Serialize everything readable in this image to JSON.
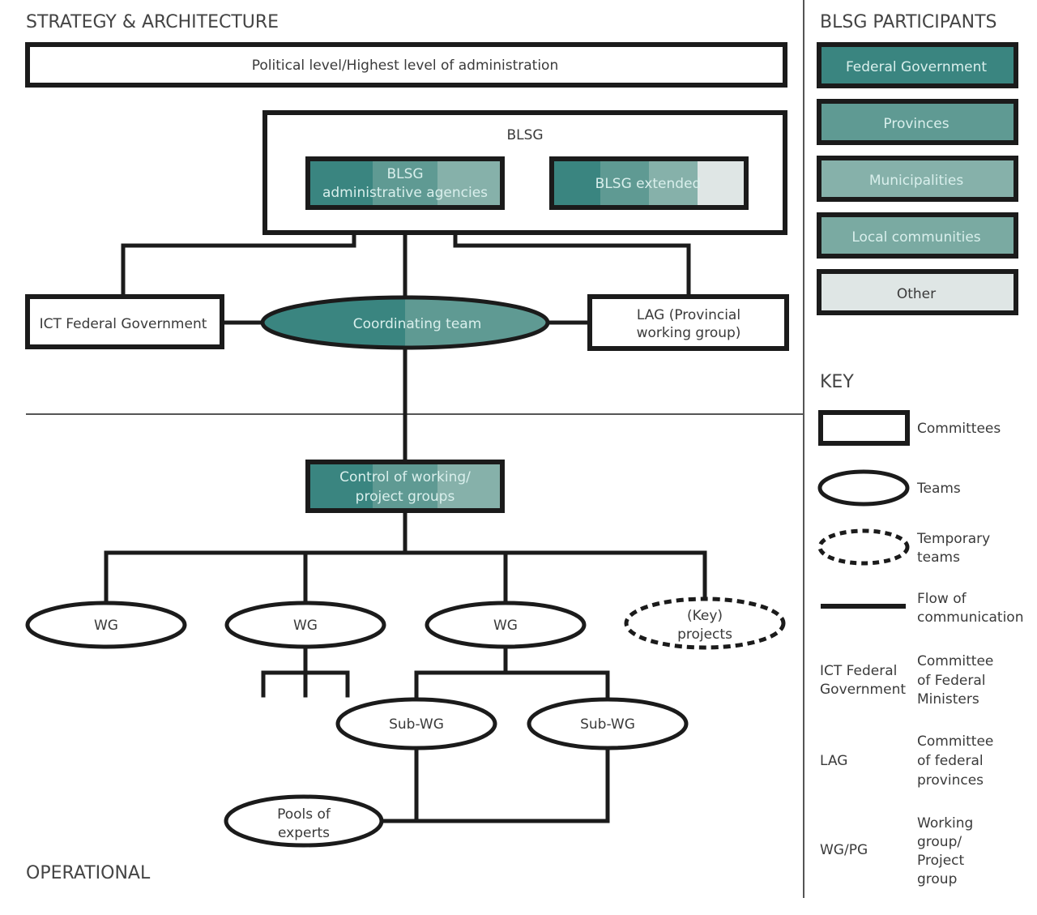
{
  "colors": {
    "federal": "#3a8580",
    "provinces": "#5f9a93",
    "municipalities": "#86b1aa",
    "local": "#7aaaa2",
    "other": "#dfe6e5",
    "line": "#1b1b1b",
    "text": "#3a3a3a",
    "light_text": "#d9efec"
  },
  "sections": {
    "strategy": "STRATEGY & ARCHITECTURE",
    "operational": "OPERATIONAL",
    "participants": "BLSG PARTICIPANTS",
    "key": "KEY"
  },
  "nodes": {
    "political": "Political level/Highest level of administration",
    "blsg": "BLSG",
    "blsg_admin_line1": "BLSG",
    "blsg_admin_line2": "administrative agencies",
    "blsg_extended": "BLSG extended",
    "ict": "ICT Federal Government",
    "coord": "Coordinating team",
    "lag_line1": "LAG (Provincial",
    "lag_line2": "working group)",
    "control_line1": "Control of working/",
    "control_line2": "project groups",
    "wg1": "WG",
    "wg2": "WG",
    "wg3": "WG",
    "key_projects_line1": "(Key)",
    "key_projects_line2": "projects",
    "subwg1": "Sub-WG",
    "subwg2": "Sub-WG",
    "pools_line1": "Pools of",
    "pools_line2": "experts"
  },
  "participants": [
    {
      "label": "Federal Government"
    },
    {
      "label": "Provinces"
    },
    {
      "label": "Municipalities"
    },
    {
      "label": "Local communities"
    },
    {
      "label": "Other"
    }
  ],
  "key": {
    "committees": "Committees",
    "teams": "Teams",
    "temporary_line1": "Temporary",
    "temporary_line2": "teams",
    "flow_line1": "Flow of",
    "flow_line2": "communication"
  },
  "abbreviations": [
    {
      "term_line1": "ICT Federal",
      "term_line2": "Government",
      "def_line1": "Committee",
      "def_line2": "of Federal",
      "def_line3": "Ministers",
      "def_line4": ""
    },
    {
      "term_line1": "LAG",
      "term_line2": "",
      "def_line1": "Committee",
      "def_line2": "of federal",
      "def_line3": "provinces",
      "def_line4": ""
    },
    {
      "term_line1": "WG/PG",
      "term_line2": "",
      "def_line1": "Working",
      "def_line2": "group/",
      "def_line3": "Project",
      "def_line4": "group"
    }
  ]
}
